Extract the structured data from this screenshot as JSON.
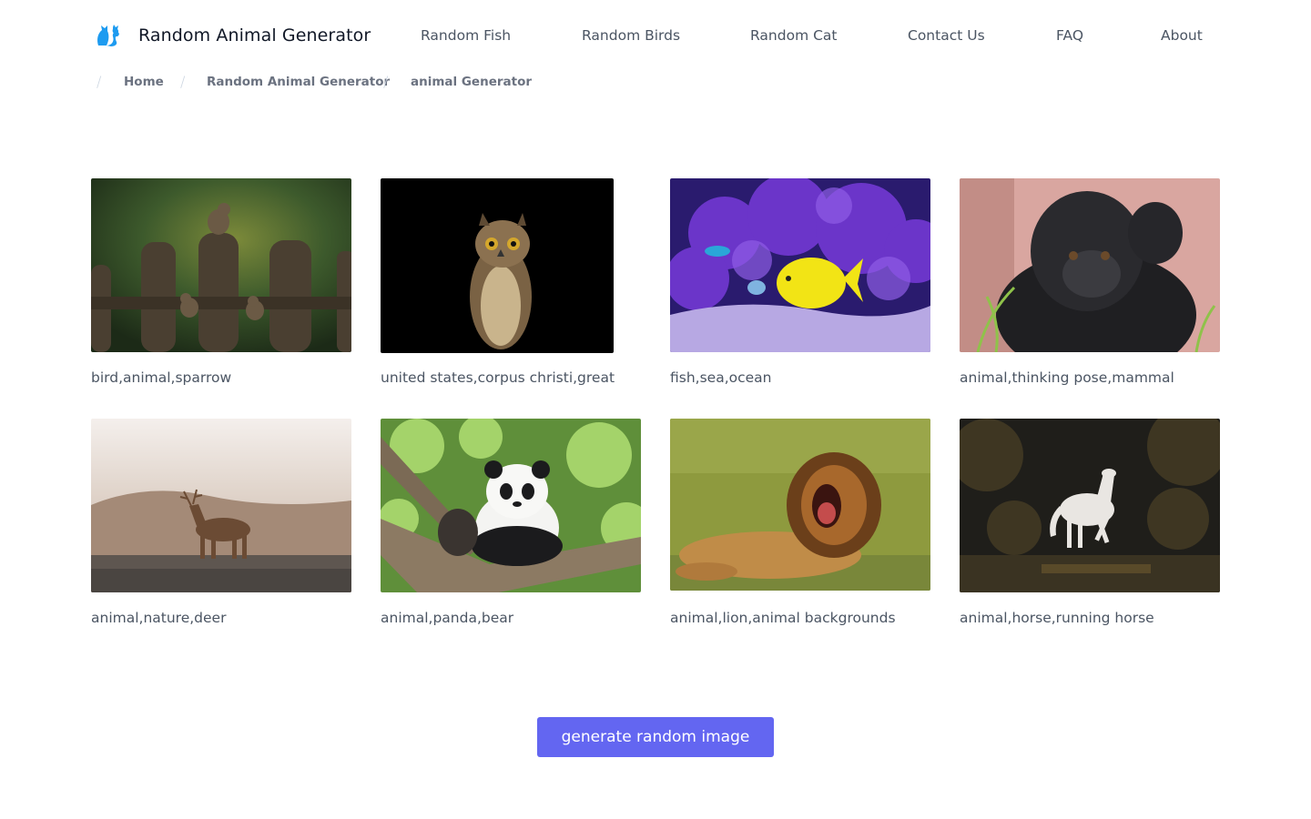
{
  "header": {
    "title": "Random Animal Generator",
    "logo_icon": "cat-logo-icon",
    "nav": [
      {
        "label": "Random Fish"
      },
      {
        "label": "Random Birds"
      },
      {
        "label": "Random Cat"
      },
      {
        "label": "Contact Us"
      },
      {
        "label": "FAQ"
      },
      {
        "label": "About"
      }
    ]
  },
  "breadcrumb": [
    {
      "label": "Home"
    },
    {
      "label": "Random Animal Generator"
    },
    {
      "label": "animal Generator"
    }
  ],
  "gallery": [
    {
      "caption": "bird,animal,sparrow",
      "image": "sparrows-on-fence"
    },
    {
      "caption": "united states,corpus christi,great",
      "image": "great-horned-owl"
    },
    {
      "caption": "fish,sea,ocean",
      "image": "yellow-tang-fish"
    },
    {
      "caption": "animal,thinking pose,mammal",
      "image": "gorilla"
    },
    {
      "caption": "animal,nature,deer",
      "image": "deer-in-mist"
    },
    {
      "caption": "animal,panda,bear",
      "image": "panda-in-tree"
    },
    {
      "caption": "animal,lion,animal backgrounds",
      "image": "roaring-lion"
    },
    {
      "caption": "animal,horse,running horse",
      "image": "white-horse-running"
    }
  ],
  "generate_button": {
    "label": "generate random image"
  },
  "colors": {
    "accent": "#6366f1",
    "logo": "#1d9bf0"
  }
}
